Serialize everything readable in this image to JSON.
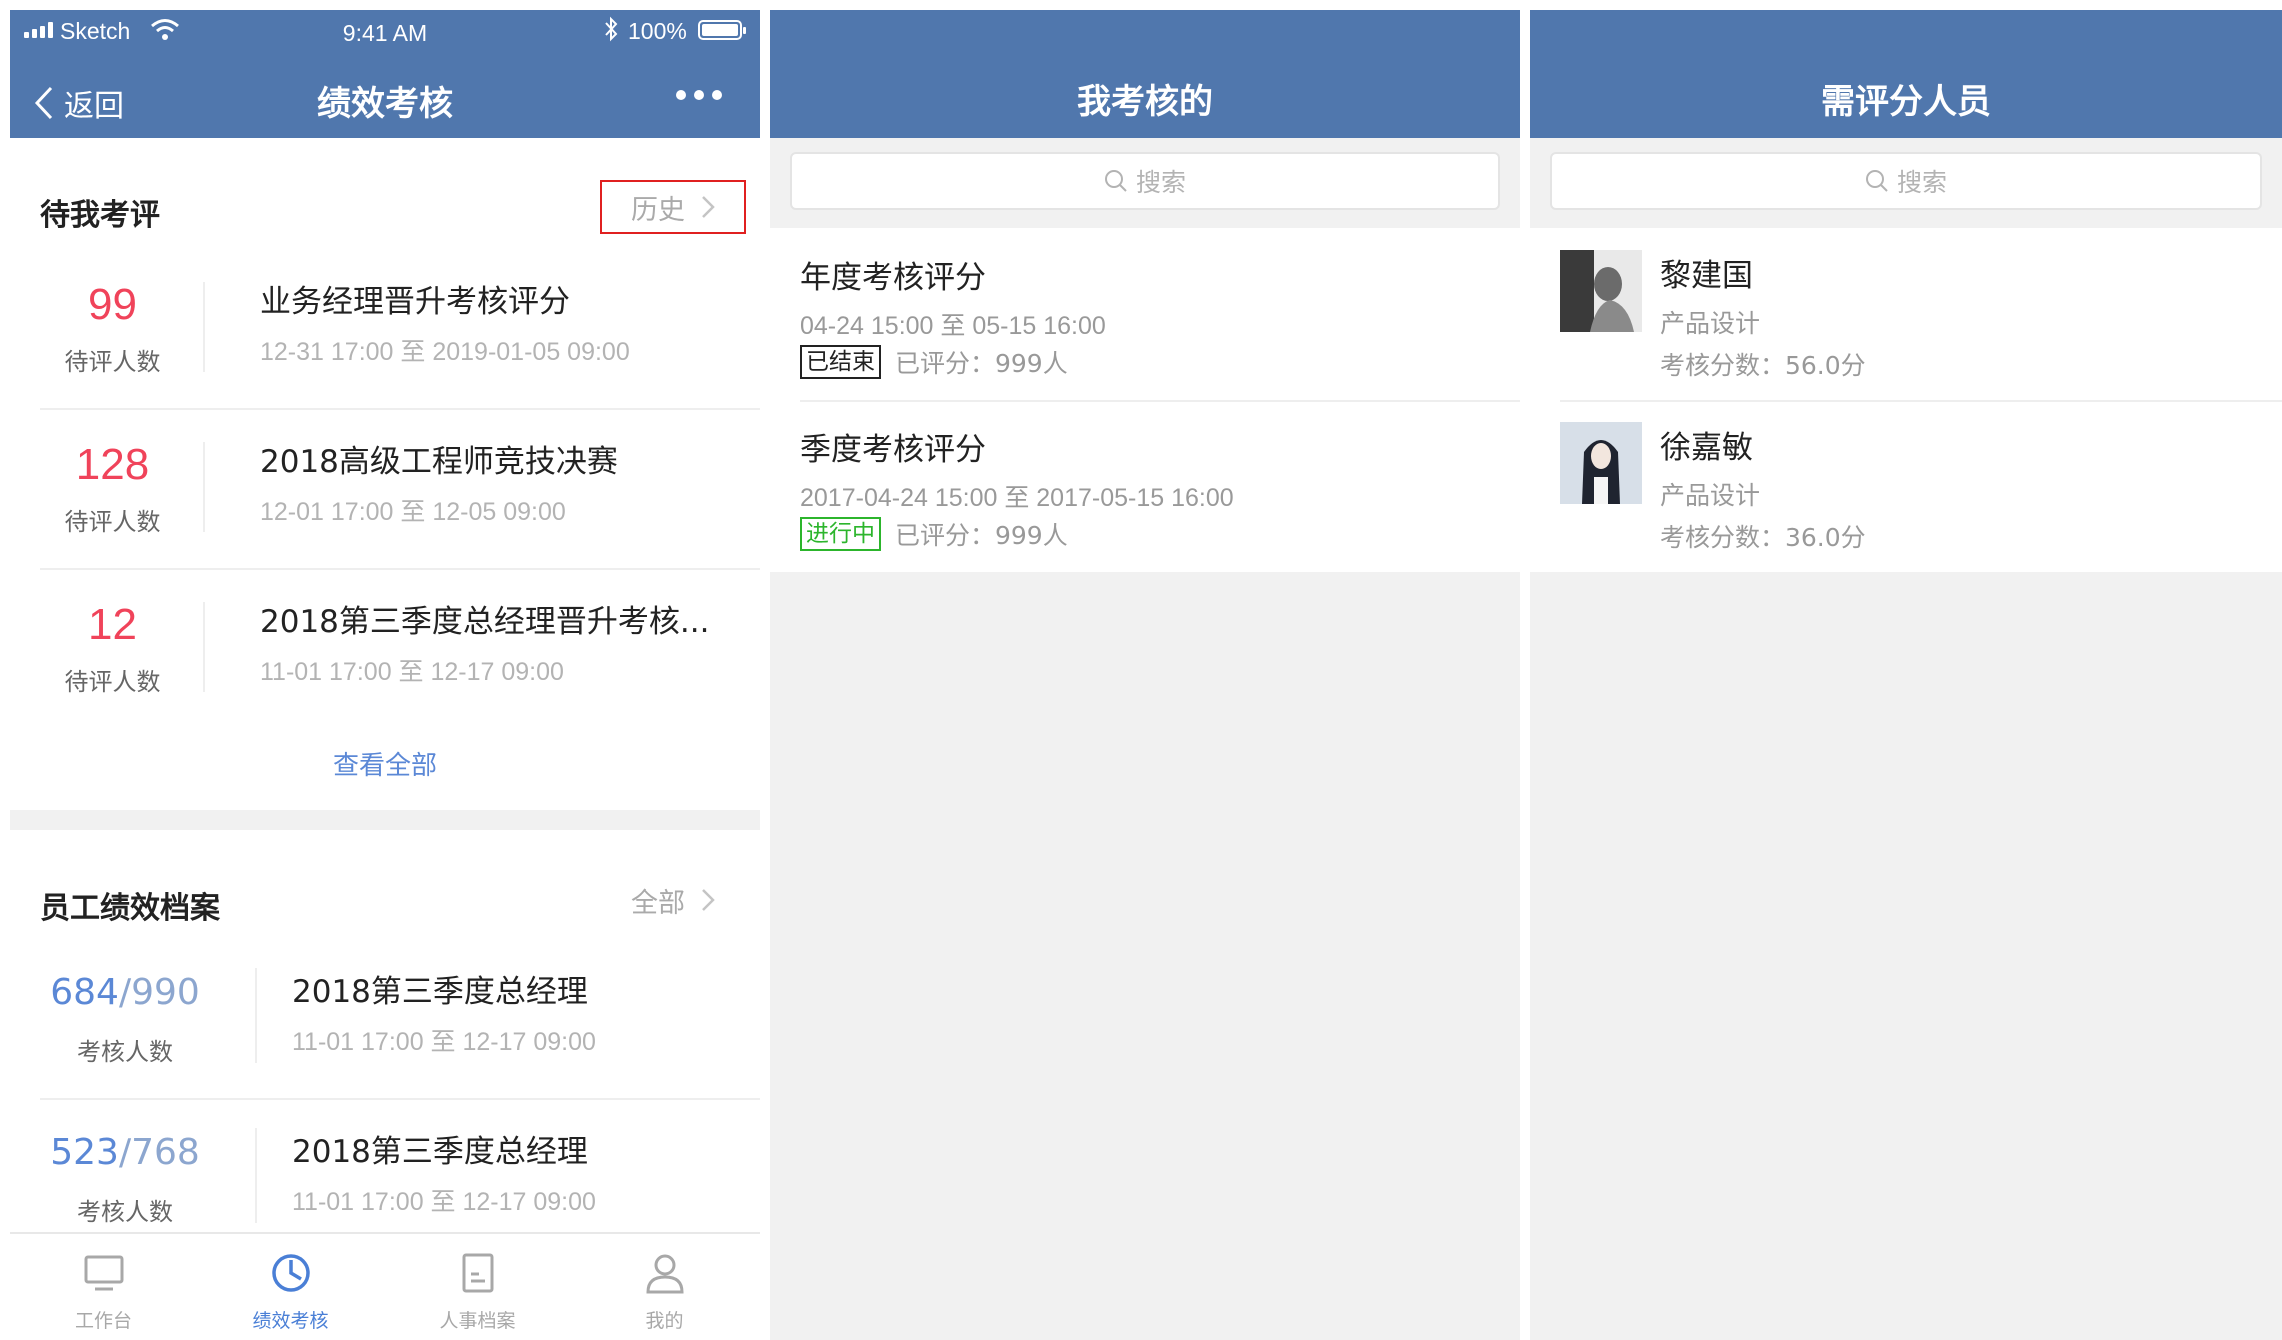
{
  "status": {
    "carrier": "Sketch",
    "time": "9:41 AM",
    "battery": "100%"
  },
  "screen1": {
    "back_label": "返回",
    "title": "绩效考核",
    "pending": {
      "title": "待我考评",
      "history_label": "历史",
      "rows": [
        {
          "count": "99",
          "count_label": "待评人数",
          "title": "业务经理晋升考核评分",
          "date": "12-31 17:00 至 2019-01-05 09:00"
        },
        {
          "count": "128",
          "count_label": "待评人数",
          "title": "2018高级工程师竞技决赛",
          "date": "12-01 17:00 至 12-05 09:00"
        },
        {
          "count": "12",
          "count_label": "待评人数",
          "title": "2018第三季度总经理晋升考核...",
          "date": "11-01 17:00 至 12-17 09:00"
        }
      ],
      "see_all": "查看全部"
    },
    "archive": {
      "title": "员工绩效档案",
      "all_label": "全部",
      "rows": [
        {
          "done": "684",
          "total": "/990",
          "label": "考核人数",
          "title": "2018第三季度总经理",
          "date": "11-01 17:00 至 12-17 09:00"
        },
        {
          "done": "523",
          "total": "/768",
          "label": "考核人数",
          "title": "2018第三季度总经理",
          "date": "11-01 17:00 至 12-17 09:00"
        }
      ]
    },
    "tabs": [
      {
        "label": "工作台",
        "icon": "desktop-icon",
        "active": false
      },
      {
        "label": "绩效考核",
        "icon": "pie-chart-icon",
        "active": true
      },
      {
        "label": "人事档案",
        "icon": "document-icon",
        "active": false
      },
      {
        "label": "我的",
        "icon": "user-icon",
        "active": false
      }
    ]
  },
  "screen2": {
    "title": "我考核的",
    "search_placeholder": "搜索",
    "items": [
      {
        "title": "年度考核评分",
        "date": "04-24 15:00 至 05-15 16:00",
        "status": "已结束",
        "rated": "已评分：999人"
      },
      {
        "title": "季度考核评分",
        "date": "2017-04-24 15:00 至 2017-05-15 16:00",
        "status": "进行中",
        "rated": "已评分：999人"
      }
    ]
  },
  "screen3": {
    "title": "需评分人员",
    "search_placeholder": "搜索",
    "people": [
      {
        "name": "黎建国",
        "role": "产品设计",
        "score": "考核分数：56.0分"
      },
      {
        "name": "徐嘉敏",
        "role": "产品设计",
        "score": "考核分数：36.0分"
      }
    ]
  },
  "colors": {
    "navbar": "#5077ad",
    "accent_red": "#f0435a",
    "accent_blue": "#5b88d6",
    "status_running": "#2cb52c",
    "highlight_box": "#e02020"
  }
}
